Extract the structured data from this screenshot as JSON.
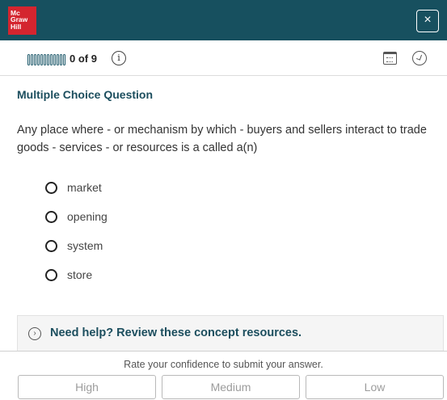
{
  "header": {
    "logo_lines": [
      "Mc",
      "Graw",
      "Hill"
    ],
    "close_label": "×"
  },
  "progress": {
    "label": "0 of 9",
    "answered": 0,
    "total": 9,
    "info_label": "i"
  },
  "question": {
    "type": "Multiple Choice Question",
    "text": "Any place where - or mechanism by which - buyers and sellers interact to trade goods - services - or resources is a called a(n)",
    "choices": [
      "market",
      "opening",
      "system",
      "store"
    ]
  },
  "help": {
    "icon": "chevron-right-circle",
    "label": "Need help? Review these concept resources."
  },
  "footer": {
    "prompt": "Rate your confidence to submit your answer.",
    "buttons": [
      "High",
      "Medium",
      "Low"
    ]
  },
  "colors": {
    "header_bg": "#17505f",
    "logo_bg": "#d4252f",
    "accent_text": "#1c4e5e"
  }
}
